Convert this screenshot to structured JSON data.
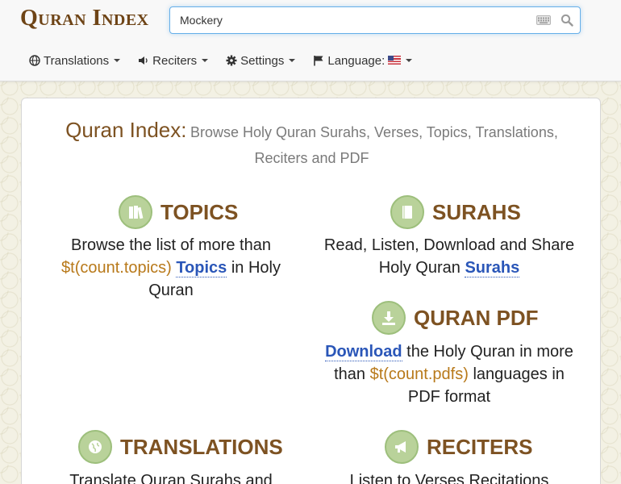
{
  "header": {
    "logo_text": "Quran Index",
    "search": {
      "value": "Mockery",
      "placeholder": ""
    },
    "nav": {
      "translations": "Translations",
      "reciters": "Reciters",
      "settings": "Settings",
      "language": "Language:"
    }
  },
  "intro": {
    "brand": "Quran Index",
    "colon": ":",
    "line1": "Browse Holy Quran Surahs, Verses, Topics, Translations,",
    "line2": "Reciters and PDF"
  },
  "features": {
    "topics": {
      "title": "TOPICS",
      "text1": "Browse the list of more than",
      "count": "$t(count.topics)",
      "link": "Topics",
      "text2": "in Holy",
      "text3": "Quran"
    },
    "surahs": {
      "title": "SURAHS",
      "text1": "Read, Listen, Download and Share",
      "text2": "Holy Quran",
      "link": "Surahs"
    },
    "pdf": {
      "title": "QURAN PDF",
      "link": "Download",
      "text1": "the Holy Quran in more",
      "text2": "than",
      "count": "$t(count.pdfs)",
      "text3": "languages in",
      "text4": "PDF format"
    },
    "translations": {
      "title": "TRANSLATIONS",
      "text1": "Translate Quran Surahs and"
    },
    "reciters": {
      "title": "RECITERS",
      "text1": "Listen to Verses Recitations"
    }
  }
}
